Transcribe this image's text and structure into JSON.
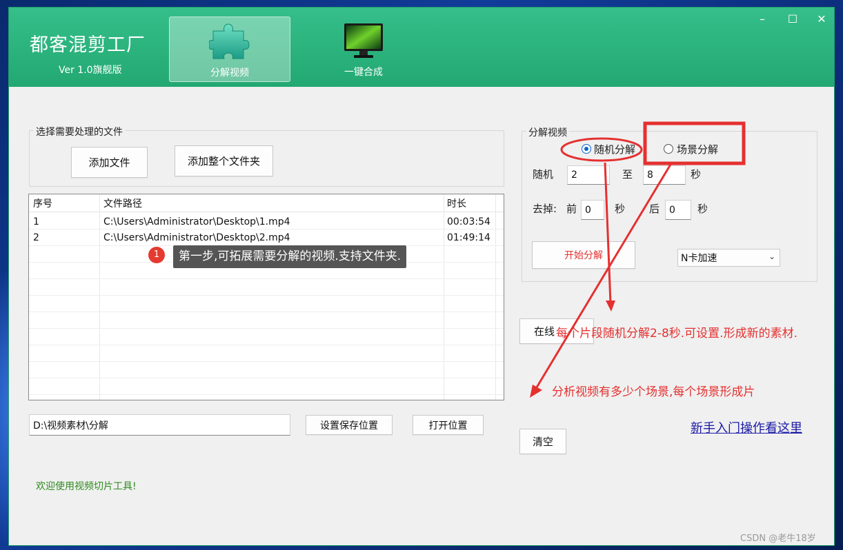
{
  "app": {
    "title": "都客混剪工厂",
    "version": "Ver 1.0旗舰版",
    "tabs": [
      {
        "label": "分解视频",
        "icon": "puzzle-icon",
        "active": true
      },
      {
        "label": "一键合成",
        "icon": "monitor-icon",
        "active": false
      }
    ],
    "window_controls": {
      "minimize": "–",
      "maximize": "☐",
      "close": "✕"
    }
  },
  "file_select": {
    "group_title": "选择需要处理的文件",
    "add_file": "添加文件",
    "add_folder": "添加整个文件夹"
  },
  "file_list": {
    "columns": [
      "序号",
      "文件路径",
      "时长"
    ],
    "rows": [
      {
        "index": "1",
        "path": "C:\\Users\\Administrator\\Desktop\\1.mp4",
        "duration": "00:03:54"
      },
      {
        "index": "2",
        "path": "C:\\Users\\Administrator\\Desktop\\2.mp4",
        "duration": "01:49:14"
      }
    ]
  },
  "save": {
    "path": "D:\\视频素材\\分解",
    "set_location": "设置保存位置",
    "open_location": "打开位置"
  },
  "status": "欢迎使用视频切片工具!",
  "split": {
    "group_title": "分解视频",
    "radio_random": "随机分解",
    "radio_scene": "场景分解",
    "random_label": "随机",
    "random_from": "2",
    "to_label": "至",
    "random_to": "8",
    "seconds_label": "秒",
    "trim_label": "去掉:",
    "front_label": "前",
    "front_value": "0",
    "back_label": "后",
    "back_value": "0",
    "start_button": "开始分解",
    "accel_option": "N卡加速",
    "online_button": "在线",
    "clear_button": "清空",
    "help_link": "新手入门操作看这里"
  },
  "annotations": {
    "step_badge": "1",
    "step_tooltip": "第一步,可拓展需要分解的视频.支持文件夹.",
    "random_note": "每个片段随机分解2-8秒.可设置.形成新的素材.",
    "scene_note": "分析视频有多少个场景,每个场景形成片",
    "accent_red": "#e53030"
  },
  "watermark": "CSDN @老牛18岁"
}
